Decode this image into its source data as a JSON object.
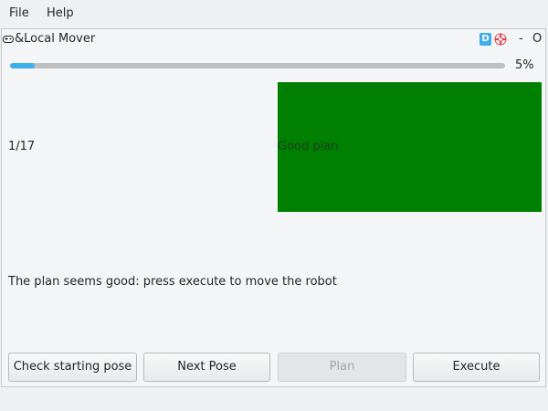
{
  "menubar": {
    "items": [
      "File",
      "Help"
    ]
  },
  "window": {
    "title": "&Local Mover",
    "badge": "D",
    "minimize": "-",
    "close": "O"
  },
  "progress": {
    "percent": 5,
    "label": "5%",
    "fill_color": "#3daee9"
  },
  "step": {
    "counter": "1/17"
  },
  "status": {
    "text": "Good plan",
    "color": "#008000"
  },
  "message": "The plan seems good: press execute to move the robot",
  "buttons": {
    "check_pose": "Check starting pose",
    "next_pose": "Next Pose",
    "plan": "Plan",
    "execute": "Execute"
  },
  "icons": {
    "app": "gamepad-icon",
    "help": "lifebuoy-icon"
  }
}
